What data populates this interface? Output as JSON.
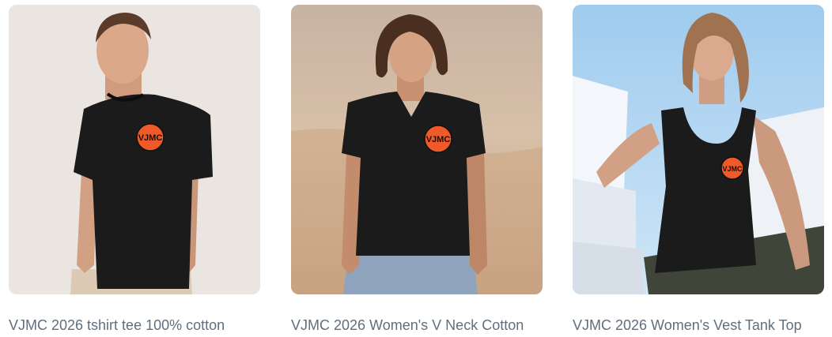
{
  "products": [
    {
      "title": "VJMC 2026 tshirt tee 100% cotton",
      "image_desc": "Man wearing black crew neck t-shirt with VJMC logo",
      "badge_text": "VJMC"
    },
    {
      "title": "VJMC 2026 Women's V Neck Cotton",
      "image_desc": "Woman wearing black v-neck t-shirt with VJMC logo",
      "badge_text": "VJMC"
    },
    {
      "title": "VJMC 2026 Women's Vest Tank Top",
      "image_desc": "Woman wearing black tank top with VJMC logo",
      "badge_text": "VJMC"
    }
  ],
  "colors": {
    "title_text": "#5f6f7f",
    "logo_orange": "#f05a28",
    "garment": "#1b1b1b"
  }
}
